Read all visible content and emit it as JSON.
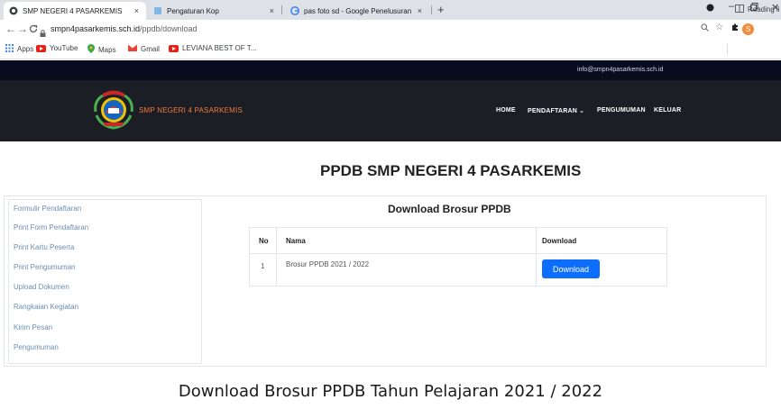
{
  "browser": {
    "tabs": [
      {
        "title": "SMP NEGERI 4 PASARKEMIS",
        "close": "×"
      },
      {
        "title": "Pengaturan Kop",
        "close": "×"
      },
      {
        "title": "pas foto sd - Google Penelusuran",
        "close": "×"
      }
    ],
    "new_tab": "+",
    "url_host": "smpn4pasarkemis.sch.id",
    "url_path": "/ppdb/download",
    "bookmarks": [
      "Apps",
      "YouTube",
      "Maps",
      "Gmail",
      "LEVIANA BEST OF T..."
    ],
    "reading_list": "Reading li",
    "profile_initial": "S"
  },
  "site": {
    "email": "info@smpn4pasarkemis.sch.id",
    "name": "SMP NEGERI 4 PASARKEMIS",
    "nav": [
      "HOME",
      "PENDAFTARAN",
      "PENGUMUMAN",
      "KELUAR"
    ]
  },
  "page": {
    "title": "PPDB SMP NEGERI 4 PASARKEMIS",
    "sidebar": [
      "Formulir Pendaftaran",
      "Print Form Pendaftaran",
      "Print Kartu Peserta",
      "Print Pengumuman",
      "Upload Dokumen",
      "Rangkaian Kegiatan",
      "Kirim Pesan",
      "Pengumuman"
    ],
    "section_title": "Download Brosur PPDB",
    "table": {
      "headers": [
        "No",
        "Nama",
        "Download"
      ],
      "rows": [
        {
          "no": "1",
          "nama": "Brosur PPDB 2021 / 2022",
          "button": "Download"
        }
      ]
    }
  },
  "caption": "Download Brosur PPDB Tahun Pelajaran 2021 / 2022",
  "colors": {
    "accent": "#0d6efd",
    "header_dark": "#1c1e26",
    "brand_orange": "#f07a3a",
    "sidebar_link": "#6a8fb4"
  }
}
